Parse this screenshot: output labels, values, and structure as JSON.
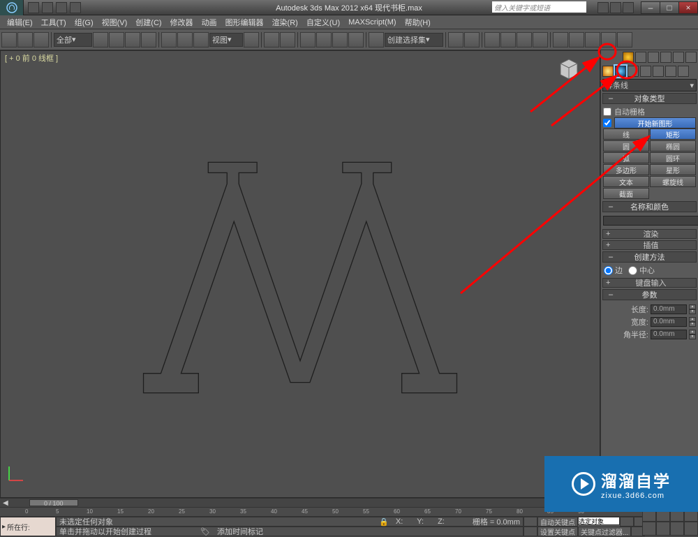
{
  "title": "Autodesk 3ds Max  2012 x64    现代书柜.max",
  "search_placeholder": "健入关键字或短语",
  "menus": [
    "编辑(E)",
    "工具(T)",
    "组(G)",
    "视图(V)",
    "创建(C)",
    "修改器",
    "动画",
    "图形编辑器",
    "渲染(R)",
    "自定义(U)",
    "MAXScript(M)",
    "帮助(H)"
  ],
  "toolbar": {
    "layer_dd": "全部",
    "view_dd": "视图",
    "select_dd": "创建选择集"
  },
  "viewport_label": "[ + 0 前 0 线框 ]",
  "command_panel": {
    "category": "样条线",
    "rollouts": {
      "object_type_title": "对象类型",
      "auto_grid": "自动栅格",
      "start_new": "开始新图形",
      "buttons": [
        [
          "线",
          "矩形"
        ],
        [
          "圆",
          "椭圆"
        ],
        [
          "弧",
          "圆环"
        ],
        [
          "多边形",
          "星形"
        ],
        [
          "文本",
          "螺旋线"
        ],
        [
          "截面",
          ""
        ]
      ],
      "name_color_title": "名称和颜色",
      "render_title": "渲染",
      "interp_title": "插值",
      "creation_title": "创建方法",
      "radio_edge": "边",
      "radio_center": "中心",
      "keyboard_title": "键盘输入",
      "params_title": "参数",
      "length_label": "长度:",
      "length_val": "0.0mm",
      "width_label": "宽度:",
      "width_val": "0.0mm",
      "corner_label": "角半径:",
      "corner_val": "0.0mm"
    }
  },
  "timeline": {
    "pos_label": "0 / 100",
    "ticks": [
      0,
      5,
      10,
      15,
      20,
      25,
      30,
      35,
      40,
      45,
      50,
      55,
      60,
      65,
      70,
      75,
      80,
      85,
      90
    ]
  },
  "status": {
    "track_label": "所在行:",
    "sel_none": "未选定任何对象",
    "prompt": "单击并拖动以开始创建过程",
    "add_marker": "添加时间标记",
    "x": "X:",
    "y": "Y:",
    "z": "Z:",
    "grid": "栅格 = 0.0mm",
    "autokey": "自动关键点",
    "selset": "选定对象",
    "setkey": "设置关键点",
    "keyfilter": "关键点过滤器..."
  },
  "watermark": {
    "big": "溜溜自学",
    "small": "zixue.3d66.com"
  }
}
